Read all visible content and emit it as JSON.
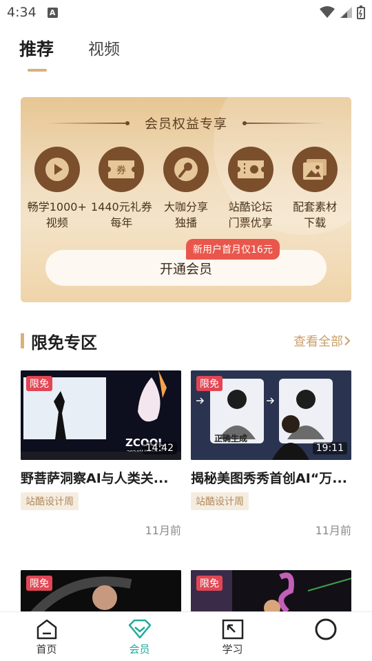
{
  "status_bar": {
    "time": "4:34",
    "notification_letter": "A"
  },
  "tabs": [
    {
      "label": "推荐",
      "active": true
    },
    {
      "label": "视频",
      "active": false
    }
  ],
  "vip_card": {
    "title": "会员权益专享",
    "benefits": [
      {
        "icon": "play-icon",
        "label": "畅学1000+\n视频"
      },
      {
        "icon": "coupon-icon",
        "label": "1440元礼券\n每年"
      },
      {
        "icon": "microphone-icon",
        "label": "大咖分享\n独播"
      },
      {
        "icon": "ticket-icon",
        "label": "站酷论坛\n门票优享"
      },
      {
        "icon": "image-icon",
        "label": "配套素材\n下载"
      }
    ],
    "coupon_icon_text": "券",
    "promo_badge": "新用户首月仅16元",
    "join_button": "开通会员",
    "accent_color": "#7b4f2c"
  },
  "section": {
    "title": "限免专区",
    "see_all": "查看全部",
    "accent_color": "#d8b17b"
  },
  "videos": [
    {
      "badge": "限免",
      "duration": "14:42",
      "title": "野菩萨洞察AI与人类关...",
      "tag": "站酷设计周",
      "time": "11月前",
      "thumb_text": "ZCOOL",
      "thumb_sub": "2024站酷设计周",
      "thumb_caption": ""
    },
    {
      "badge": "限免",
      "duration": "19:11",
      "title": "揭秘美图秀秀首创AI“万...",
      "tag": "站酷设计周",
      "time": "11月前",
      "thumb_text": "",
      "thumb_sub": "",
      "thumb_caption": "正确生成"
    },
    {
      "badge": "限免",
      "duration": "",
      "title": "",
      "tag": "",
      "time": "",
      "thumb_text": "",
      "thumb_sub": "",
      "thumb_caption": ""
    },
    {
      "badge": "限免",
      "duration": "",
      "title": "",
      "tag": "",
      "time": "",
      "thumb_text": "",
      "thumb_sub": "",
      "thumb_caption": ""
    }
  ],
  "bottom_nav": [
    {
      "label": "首页",
      "icon": "home-icon",
      "active": false
    },
    {
      "label": "会员",
      "icon": "diamond-icon",
      "active": true
    },
    {
      "label": "学习",
      "icon": "study-icon",
      "active": false
    },
    {
      "label": "",
      "icon": "profile-circle-icon",
      "active": false
    }
  ],
  "colors": {
    "active_nav": "#20a99c",
    "free_badge": "#e24654",
    "promo": "#e9574c"
  }
}
